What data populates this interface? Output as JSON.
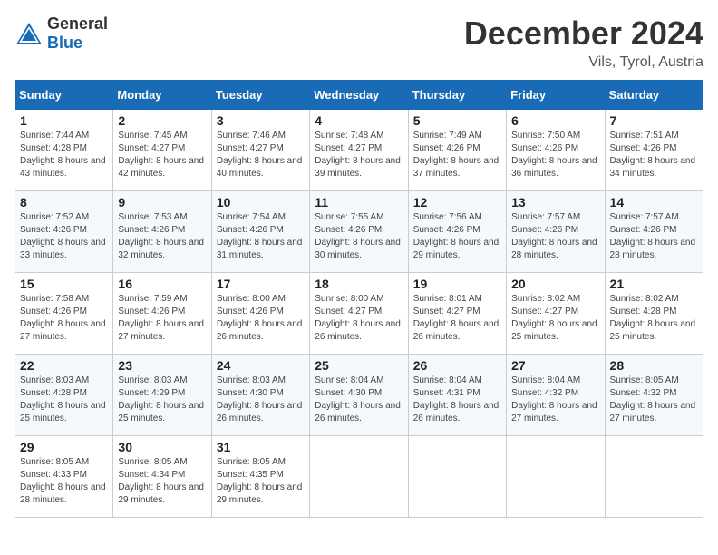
{
  "logo": {
    "text1": "General",
    "text2": "Blue"
  },
  "title": "December 2024",
  "location": "Vils, Tyrol, Austria",
  "days_of_week": [
    "Sunday",
    "Monday",
    "Tuesday",
    "Wednesday",
    "Thursday",
    "Friday",
    "Saturday"
  ],
  "weeks": [
    [
      {
        "day": "1",
        "sunrise": "7:44 AM",
        "sunset": "4:28 PM",
        "daylight": "8 hours and 43 minutes."
      },
      {
        "day": "2",
        "sunrise": "7:45 AM",
        "sunset": "4:27 PM",
        "daylight": "8 hours and 42 minutes."
      },
      {
        "day": "3",
        "sunrise": "7:46 AM",
        "sunset": "4:27 PM",
        "daylight": "8 hours and 40 minutes."
      },
      {
        "day": "4",
        "sunrise": "7:48 AM",
        "sunset": "4:27 PM",
        "daylight": "8 hours and 39 minutes."
      },
      {
        "day": "5",
        "sunrise": "7:49 AM",
        "sunset": "4:26 PM",
        "daylight": "8 hours and 37 minutes."
      },
      {
        "day": "6",
        "sunrise": "7:50 AM",
        "sunset": "4:26 PM",
        "daylight": "8 hours and 36 minutes."
      },
      {
        "day": "7",
        "sunrise": "7:51 AM",
        "sunset": "4:26 PM",
        "daylight": "8 hours and 34 minutes."
      }
    ],
    [
      {
        "day": "8",
        "sunrise": "7:52 AM",
        "sunset": "4:26 PM",
        "daylight": "8 hours and 33 minutes."
      },
      {
        "day": "9",
        "sunrise": "7:53 AM",
        "sunset": "4:26 PM",
        "daylight": "8 hours and 32 minutes."
      },
      {
        "day": "10",
        "sunrise": "7:54 AM",
        "sunset": "4:26 PM",
        "daylight": "8 hours and 31 minutes."
      },
      {
        "day": "11",
        "sunrise": "7:55 AM",
        "sunset": "4:26 PM",
        "daylight": "8 hours and 30 minutes."
      },
      {
        "day": "12",
        "sunrise": "7:56 AM",
        "sunset": "4:26 PM",
        "daylight": "8 hours and 29 minutes."
      },
      {
        "day": "13",
        "sunrise": "7:57 AM",
        "sunset": "4:26 PM",
        "daylight": "8 hours and 28 minutes."
      },
      {
        "day": "14",
        "sunrise": "7:57 AM",
        "sunset": "4:26 PM",
        "daylight": "8 hours and 28 minutes."
      }
    ],
    [
      {
        "day": "15",
        "sunrise": "7:58 AM",
        "sunset": "4:26 PM",
        "daylight": "8 hours and 27 minutes."
      },
      {
        "day": "16",
        "sunrise": "7:59 AM",
        "sunset": "4:26 PM",
        "daylight": "8 hours and 27 minutes."
      },
      {
        "day": "17",
        "sunrise": "8:00 AM",
        "sunset": "4:26 PM",
        "daylight": "8 hours and 26 minutes."
      },
      {
        "day": "18",
        "sunrise": "8:00 AM",
        "sunset": "4:27 PM",
        "daylight": "8 hours and 26 minutes."
      },
      {
        "day": "19",
        "sunrise": "8:01 AM",
        "sunset": "4:27 PM",
        "daylight": "8 hours and 26 minutes."
      },
      {
        "day": "20",
        "sunrise": "8:02 AM",
        "sunset": "4:27 PM",
        "daylight": "8 hours and 25 minutes."
      },
      {
        "day": "21",
        "sunrise": "8:02 AM",
        "sunset": "4:28 PM",
        "daylight": "8 hours and 25 minutes."
      }
    ],
    [
      {
        "day": "22",
        "sunrise": "8:03 AM",
        "sunset": "4:28 PM",
        "daylight": "8 hours and 25 minutes."
      },
      {
        "day": "23",
        "sunrise": "8:03 AM",
        "sunset": "4:29 PM",
        "daylight": "8 hours and 25 minutes."
      },
      {
        "day": "24",
        "sunrise": "8:03 AM",
        "sunset": "4:30 PM",
        "daylight": "8 hours and 26 minutes."
      },
      {
        "day": "25",
        "sunrise": "8:04 AM",
        "sunset": "4:30 PM",
        "daylight": "8 hours and 26 minutes."
      },
      {
        "day": "26",
        "sunrise": "8:04 AM",
        "sunset": "4:31 PM",
        "daylight": "8 hours and 26 minutes."
      },
      {
        "day": "27",
        "sunrise": "8:04 AM",
        "sunset": "4:32 PM",
        "daylight": "8 hours and 27 minutes."
      },
      {
        "day": "28",
        "sunrise": "8:05 AM",
        "sunset": "4:32 PM",
        "daylight": "8 hours and 27 minutes."
      }
    ],
    [
      {
        "day": "29",
        "sunrise": "8:05 AM",
        "sunset": "4:33 PM",
        "daylight": "8 hours and 28 minutes."
      },
      {
        "day": "30",
        "sunrise": "8:05 AM",
        "sunset": "4:34 PM",
        "daylight": "8 hours and 29 minutes."
      },
      {
        "day": "31",
        "sunrise": "8:05 AM",
        "sunset": "4:35 PM",
        "daylight": "8 hours and 29 minutes."
      },
      null,
      null,
      null,
      null
    ]
  ]
}
